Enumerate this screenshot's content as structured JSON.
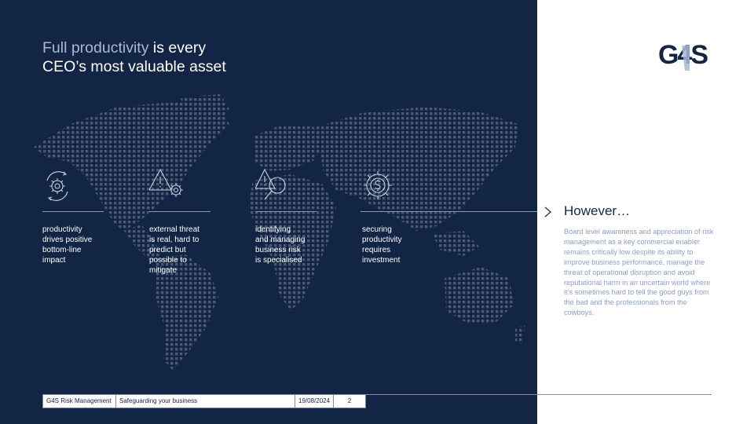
{
  "slide": {
    "title_highlight": "Full productivity",
    "title_rest_line1": " is every",
    "title_line2": "CEO’s most valuable asset",
    "logo_text": "G4S"
  },
  "pillars": [
    {
      "icon": "gear-cycle-icon",
      "text": "productivity\ndrives positive\nbottom-line\nimpact"
    },
    {
      "icon": "warning-gear-icon",
      "text": "external threat\nis real, hard to\npredict but\npossible to\nmitigate"
    },
    {
      "icon": "warning-magnifier-icon",
      "text": "identifying\nand managing\nbusiness risk\nis specialised"
    },
    {
      "icon": "dollar-gear-icon",
      "text": "securing\nproductivity\nrequires\ninvestment"
    }
  ],
  "side": {
    "heading": "However…",
    "body": "Board level awareness and appreciation of risk management as a key commercial enabler remains critically low despite its ability to improve business performance, manage the threat of operational disruption and avoid reputational harm in an uncertain world where it’s sometimes hard to tell the good guys from the bad and the professionals from the cowboys."
  },
  "footer": {
    "company": "G4S Risk Management",
    "tagline": "Safeguarding your business",
    "date": "19/08/2024",
    "page": "2"
  },
  "colors": {
    "navy": "#132544",
    "accent": "#a9b8d6",
    "body_text": "#8d9ec0"
  }
}
